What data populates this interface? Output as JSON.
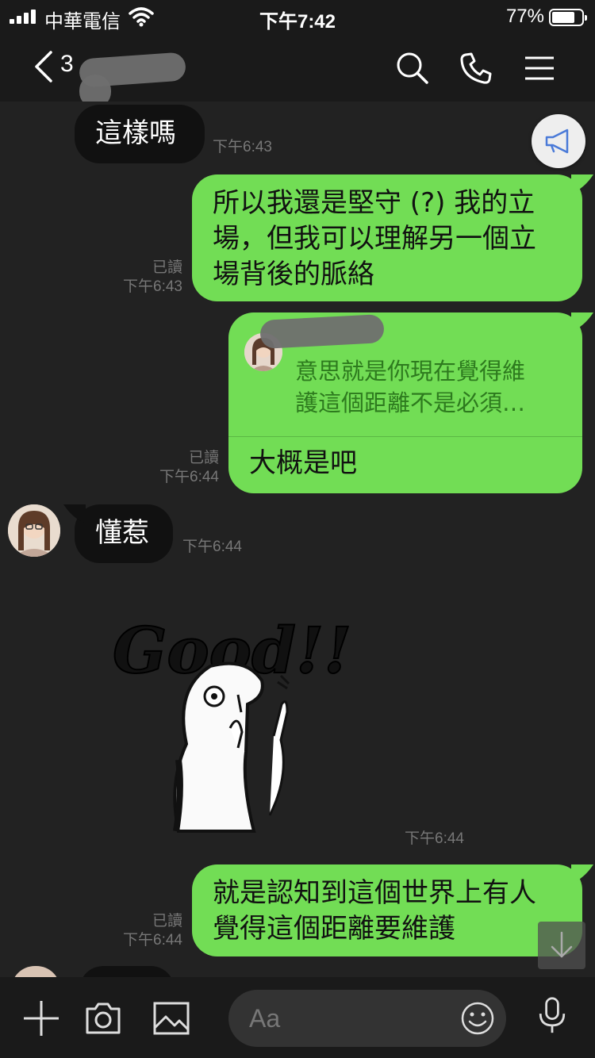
{
  "status_bar": {
    "carrier": "中華電信",
    "time": "下午7:42",
    "battery_percent": "77%"
  },
  "header": {
    "back_count": "3"
  },
  "messages": {
    "m1": {
      "text": "這樣嗎",
      "time": "下午6:43"
    },
    "m2": {
      "lines": [
        "所以我還是堅守 (?) 我的立",
        "場，但我可以理解另一個立",
        "場背後的脈絡"
      ],
      "read": "已讀",
      "time": "下午6:43"
    },
    "m3": {
      "quote_lines": [
        "意思就是你現在覺得維",
        "護這個距離不是必須…"
      ],
      "text": "大概是吧",
      "read": "已讀",
      "time": "下午6:44"
    },
    "m4": {
      "text": "懂惹",
      "time": "下午6:44"
    },
    "m5": {
      "sticker_text": "Good!!",
      "time": "下午6:44"
    },
    "m6": {
      "lines": [
        "就是認知到這個世界上有人",
        "覺得這個距離要維護"
      ],
      "read": "已讀",
      "time": "下午6:44"
    }
  },
  "composer": {
    "placeholder": "Aa"
  },
  "colors": {
    "outgoing_bubble": "#72dd55",
    "incoming_bubble": "#111111",
    "background": "#222222"
  }
}
